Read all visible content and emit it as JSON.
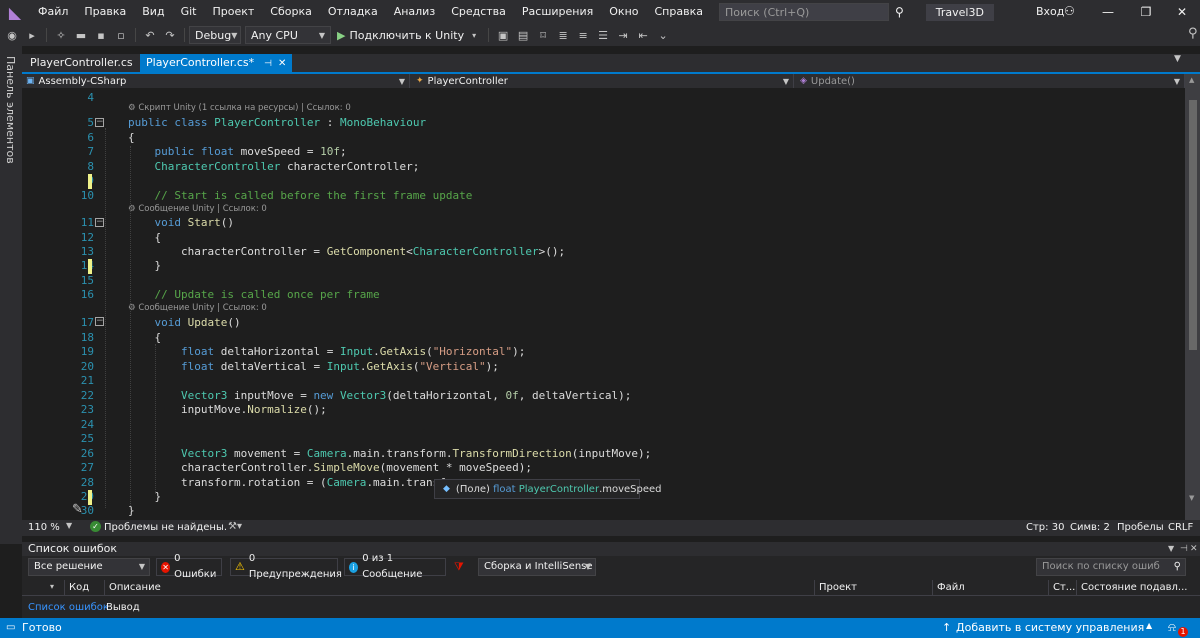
{
  "menubar": {
    "items": [
      "Файл",
      "Правка",
      "Вид",
      "Git",
      "Проект",
      "Сборка",
      "Отладка",
      "Анализ",
      "Средства",
      "Расширения",
      "Окно",
      "Справка"
    ],
    "search_placeholder": "Поиск (Ctrl+Q)",
    "solution_name": "Travel3D",
    "login_label": "Вход"
  },
  "toolbar": {
    "config": "Debug",
    "platform": "Any CPU",
    "run_label": "Подключить к Unity"
  },
  "left_panel_label": "Панель элементов",
  "tabs": [
    {
      "label": "PlayerController.cs",
      "active": false
    },
    {
      "label": "PlayerController.cs*",
      "active": true
    }
  ],
  "navbar": {
    "project": "Assembly-CSharp",
    "type": "PlayerController",
    "member": "Update()"
  },
  "code": {
    "lens_class": "⚙ Скрипт Unity (1 ссылка на ресурсы) | Ссылок: 0",
    "lens_start": "⚙ Сообщение Unity | Ссылок: 0",
    "lens_update": "⚙ Сообщение Unity | Ссылок: 0",
    "lines": [
      {
        "n": "4",
        "t": ""
      },
      {
        "n": "5",
        "t": "public class PlayerController : MonoBehaviour"
      },
      {
        "n": "6",
        "t": "{"
      },
      {
        "n": "7",
        "t": "    public float moveSpeed = 10f;"
      },
      {
        "n": "8",
        "t": "    CharacterController characterController;"
      },
      {
        "n": "9",
        "t": ""
      },
      {
        "n": "10",
        "t": "    // Start is called before the first frame update"
      },
      {
        "n": "11",
        "t": "    void Start()"
      },
      {
        "n": "12",
        "t": "    {"
      },
      {
        "n": "13",
        "t": "        characterController = GetComponent<CharacterController>();"
      },
      {
        "n": "14",
        "t": "    }"
      },
      {
        "n": "15",
        "t": ""
      },
      {
        "n": "16",
        "t": "    // Update is called once per frame"
      },
      {
        "n": "17",
        "t": "    void Update()"
      },
      {
        "n": "18",
        "t": "    {"
      },
      {
        "n": "19",
        "t": "        float deltaHorizontal = Input.GetAxis(\"Horizontal\");"
      },
      {
        "n": "20",
        "t": "        float deltaVertical = Input.GetAxis(\"Vertical\");"
      },
      {
        "n": "21",
        "t": ""
      },
      {
        "n": "22",
        "t": "        Vector3 inputMove = new Vector3(deltaHorizontal, 0f, deltaVertical);"
      },
      {
        "n": "23",
        "t": "        inputMove.Normalize();"
      },
      {
        "n": "24",
        "t": ""
      },
      {
        "n": "25",
        "t": ""
      },
      {
        "n": "26",
        "t": "        Vector3 movement = Camera.main.transform.TransformDirection(inputMove);"
      },
      {
        "n": "27",
        "t": "        characterController.SimpleMove(movement * moveSpeed);"
      },
      {
        "n": "28",
        "t": "        transform.rotation = (Camera.main.transform.ro"
      },
      {
        "n": "29",
        "t": "    }"
      },
      {
        "n": "30",
        "t": "}"
      }
    ]
  },
  "tooltip": {
    "prefix": "(Поле)",
    "keyword": "float",
    "type": "PlayerController",
    "member": ".moveSpeed"
  },
  "editor_status": {
    "zoom": "110 %",
    "issues": "Проблемы не найдены.",
    "line": "Стр: 30",
    "col": "Симв: 2",
    "spaces": "Пробелы",
    "eol": "CRLF"
  },
  "error_list": {
    "title": "Список ошибок",
    "scope": "Все решение",
    "errors": "0 Ошибки",
    "warnings": "0 Предупреждения",
    "messages": "0 из 1 Сообщение",
    "build_filter": "Сборка и IntelliSense",
    "search_placeholder": "Поиск по списку ошиб",
    "columns": [
      "Код",
      "Описание",
      "Проект",
      "Файл",
      "Ст...",
      "Состояние подавл..."
    ],
    "bottom_tabs": [
      "Список ошибок",
      "Вывод"
    ]
  },
  "statusbar": {
    "ready": "Готово",
    "source_control": "Добавить в систему управления версиями",
    "notifications": "1"
  },
  "colors": {
    "accent": "#007acc",
    "background": "#1e1e1e",
    "chrome": "#2d2d30"
  }
}
